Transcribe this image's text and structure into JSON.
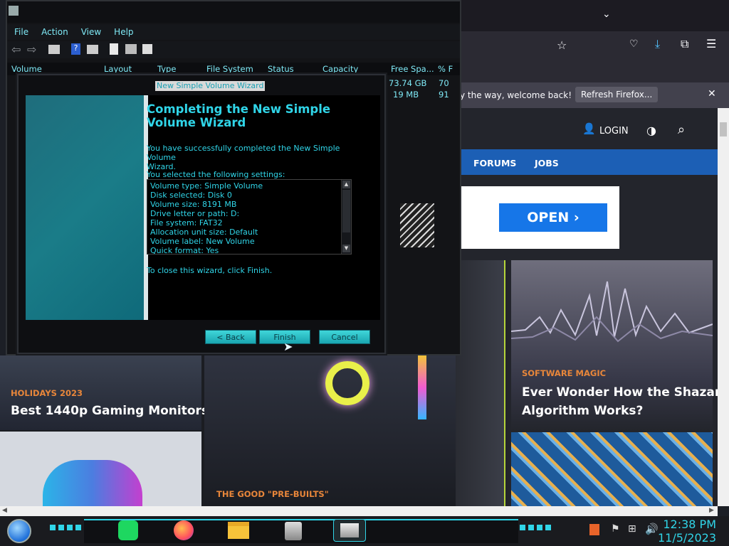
{
  "disk_mgmt": {
    "menu": [
      "File",
      "Action",
      "View",
      "Help"
    ],
    "columns": [
      "Volume",
      "Layout",
      "Type",
      "File System",
      "Status",
      "Capacity",
      "Free Spa...",
      "% F"
    ],
    "free_values": [
      "73.74 GB",
      "19 MB"
    ],
    "pct_values": [
      "70",
      "91"
    ]
  },
  "wizard": {
    "title": "New Simple Volume Wizard",
    "heading_line1": "Completing the New Simple",
    "heading_line2": "Volume Wizard",
    "success_line1": "You have successfully completed the New Simple Volume",
    "success_line2": "Wizard.",
    "selected_label": "You selected the following settings:",
    "settings": [
      "Volume type: Simple Volume",
      "Disk selected: Disk 0",
      "Volume size: 8191 MB",
      "Drive letter or path: D:",
      "File system: FAT32",
      "Allocation unit size: Default",
      "Volume label: New Volume",
      "Quick format: Yes"
    ],
    "close_text": "To close this wizard, click Finish.",
    "back_label": "< Back",
    "finish_label": "Finish",
    "cancel_label": "Cancel"
  },
  "firefox": {
    "notification": "y the way, welcome back!",
    "refresh_label": "Refresh Firefox..."
  },
  "website": {
    "login_label": "LOGIN",
    "nav": [
      "FORUMS",
      "JOBS"
    ],
    "ad_button": "OPEN",
    "cards": [
      {
        "tag": "SOFTWARE MAGIC",
        "title_line1": "Ever Wonder How the Shazam",
        "title_line2": "Algorithm Works?"
      },
      {
        "tag": "HOLIDAYS 2023",
        "title_line1": "Best 1440p Gaming Monitors"
      },
      {
        "tag": "THE GOOD \"PRE-BUILTS\""
      }
    ]
  },
  "taskbar": {
    "time": "12:38 PM",
    "date": "11/5/2023",
    "apps": [
      "spotify-icon",
      "firefox-icon",
      "file-explorer-icon",
      "installer-icon",
      "disk-management-icon"
    ]
  },
  "colors": {
    "accent_cyan": "#30d5e8",
    "site_accent": "#e8863a",
    "site_blue": "#1c5fb5"
  }
}
